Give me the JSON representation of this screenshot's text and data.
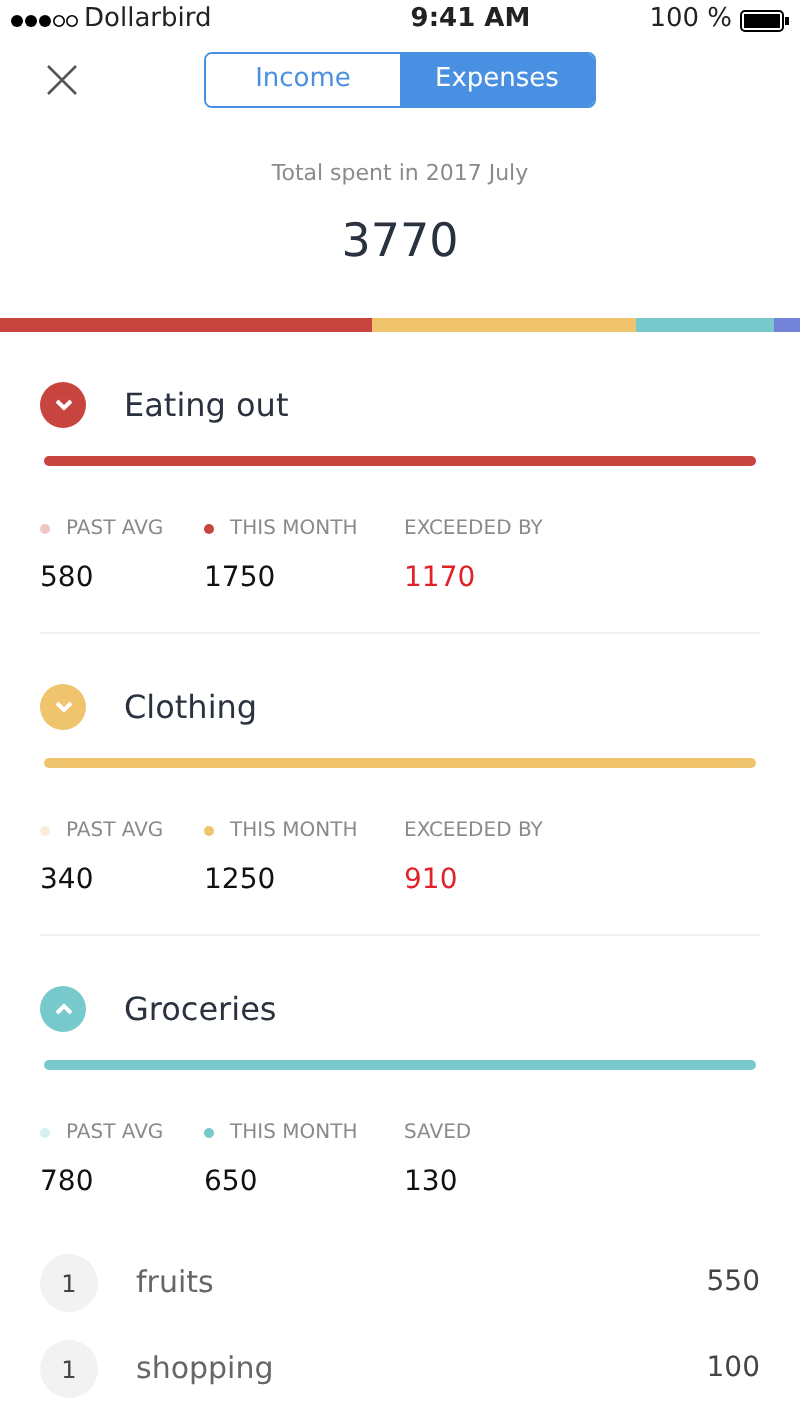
{
  "status_bar": {
    "carrier": "Dollarbird",
    "time": "9:41 AM",
    "battery": "100 %"
  },
  "tabs": [
    {
      "label": "Income",
      "selected": false
    },
    {
      "label": "Expenses",
      "selected": true
    }
  ],
  "summary": {
    "label": "Total spent in 2017 July",
    "total": "3770"
  },
  "breakdown": [
    {
      "color": "#c8443f"
    },
    {
      "color": "#f0c46c"
    },
    {
      "color": "#77c9cb"
    },
    {
      "color": "#7384d8"
    }
  ],
  "categories": [
    {
      "name": "Eating out",
      "color": "#c8443f",
      "expanded": false,
      "past_label": "PAST AVG",
      "past": "580",
      "month_label": "THIS MONTH",
      "month": "1750",
      "kind": "exceeded",
      "diff_label": "EXCEEDED BY",
      "diff": "1170"
    },
    {
      "name": "Clothing",
      "color": "#f0c46c",
      "expanded": false,
      "past_label": "PAST AVG",
      "past": "340",
      "month_label": "THIS MONTH",
      "month": "1250",
      "kind": "exceeded",
      "diff_label": "EXCEEDED BY",
      "diff": "910"
    },
    {
      "name": "Groceries",
      "color": "#77c9cb",
      "expanded": true,
      "past_label": "PAST AVG",
      "past": "780",
      "month_label": "THIS MONTH",
      "month": "650",
      "kind": "saved",
      "diff_label": "SAVED",
      "diff": "130",
      "items": [
        {
          "count": "1",
          "name": "fruits",
          "amount": "550"
        },
        {
          "count": "1",
          "name": "shopping",
          "amount": "100"
        }
      ]
    }
  ]
}
